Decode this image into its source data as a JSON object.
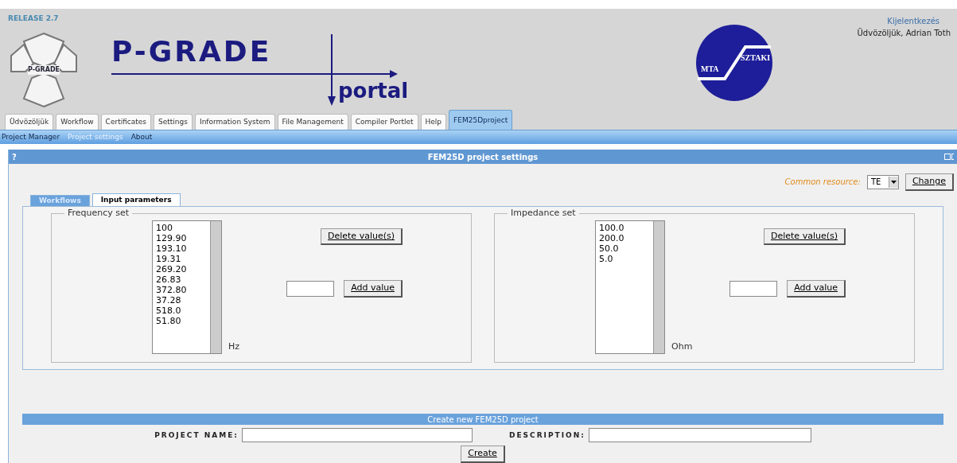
{
  "header": {
    "release": "RELEASE 2.7",
    "emblem_text": "P-GRADE",
    "logo_title": "P-GRADE",
    "logo_subtitle": "portal",
    "partner_left": "MTA",
    "partner_right": "SZTAKI",
    "logout": "Kijelentkezés",
    "greeting": "Üdvözöljük, Adrian Toth"
  },
  "tabs": [
    {
      "label": "Üdvözöljük",
      "selected": false
    },
    {
      "label": "Workflow",
      "selected": false
    },
    {
      "label": "Certificates",
      "selected": false
    },
    {
      "label": "Settings",
      "selected": false
    },
    {
      "label": "Information System",
      "selected": false
    },
    {
      "label": "File Management",
      "selected": false
    },
    {
      "label": "Compiler Portlet",
      "selected": false
    },
    {
      "label": "Help",
      "selected": false
    },
    {
      "label": "FEM25Dproject",
      "selected": true
    }
  ],
  "subnav": [
    {
      "label": "Project Manager",
      "selected": false
    },
    {
      "label": "Project settings",
      "selected": true
    },
    {
      "label": "About",
      "selected": false
    }
  ],
  "panel": {
    "help": "?",
    "title": "FEM25D project settings",
    "resource_label": "Common resource:",
    "resource_value": "TE",
    "change_button": "Change",
    "inner_tabs": [
      {
        "label": "Workflows",
        "selected": false
      },
      {
        "label": "Input parameters",
        "selected": true
      }
    ],
    "sets": [
      {
        "legend": "Frequency set",
        "values": [
          "100",
          "129.90",
          "193.10",
          "19.31",
          "269.20",
          "26.83",
          "372.80",
          "37.28",
          "518.0",
          "51.80"
        ],
        "unit": "Hz",
        "delete_button": "Delete value(s)",
        "add_button": "Add value"
      },
      {
        "legend": "Impedance set",
        "values": [
          "100.0",
          "200.0",
          "50.0",
          "5.0"
        ],
        "unit": "Ohm",
        "delete_button": "Delete value(s)",
        "add_button": "Add value"
      }
    ]
  },
  "create": {
    "title": "Create new FEM25D project",
    "name_label": "PROJECT NAME:",
    "description_label": "DESCRIPTION:",
    "button": "Create"
  }
}
